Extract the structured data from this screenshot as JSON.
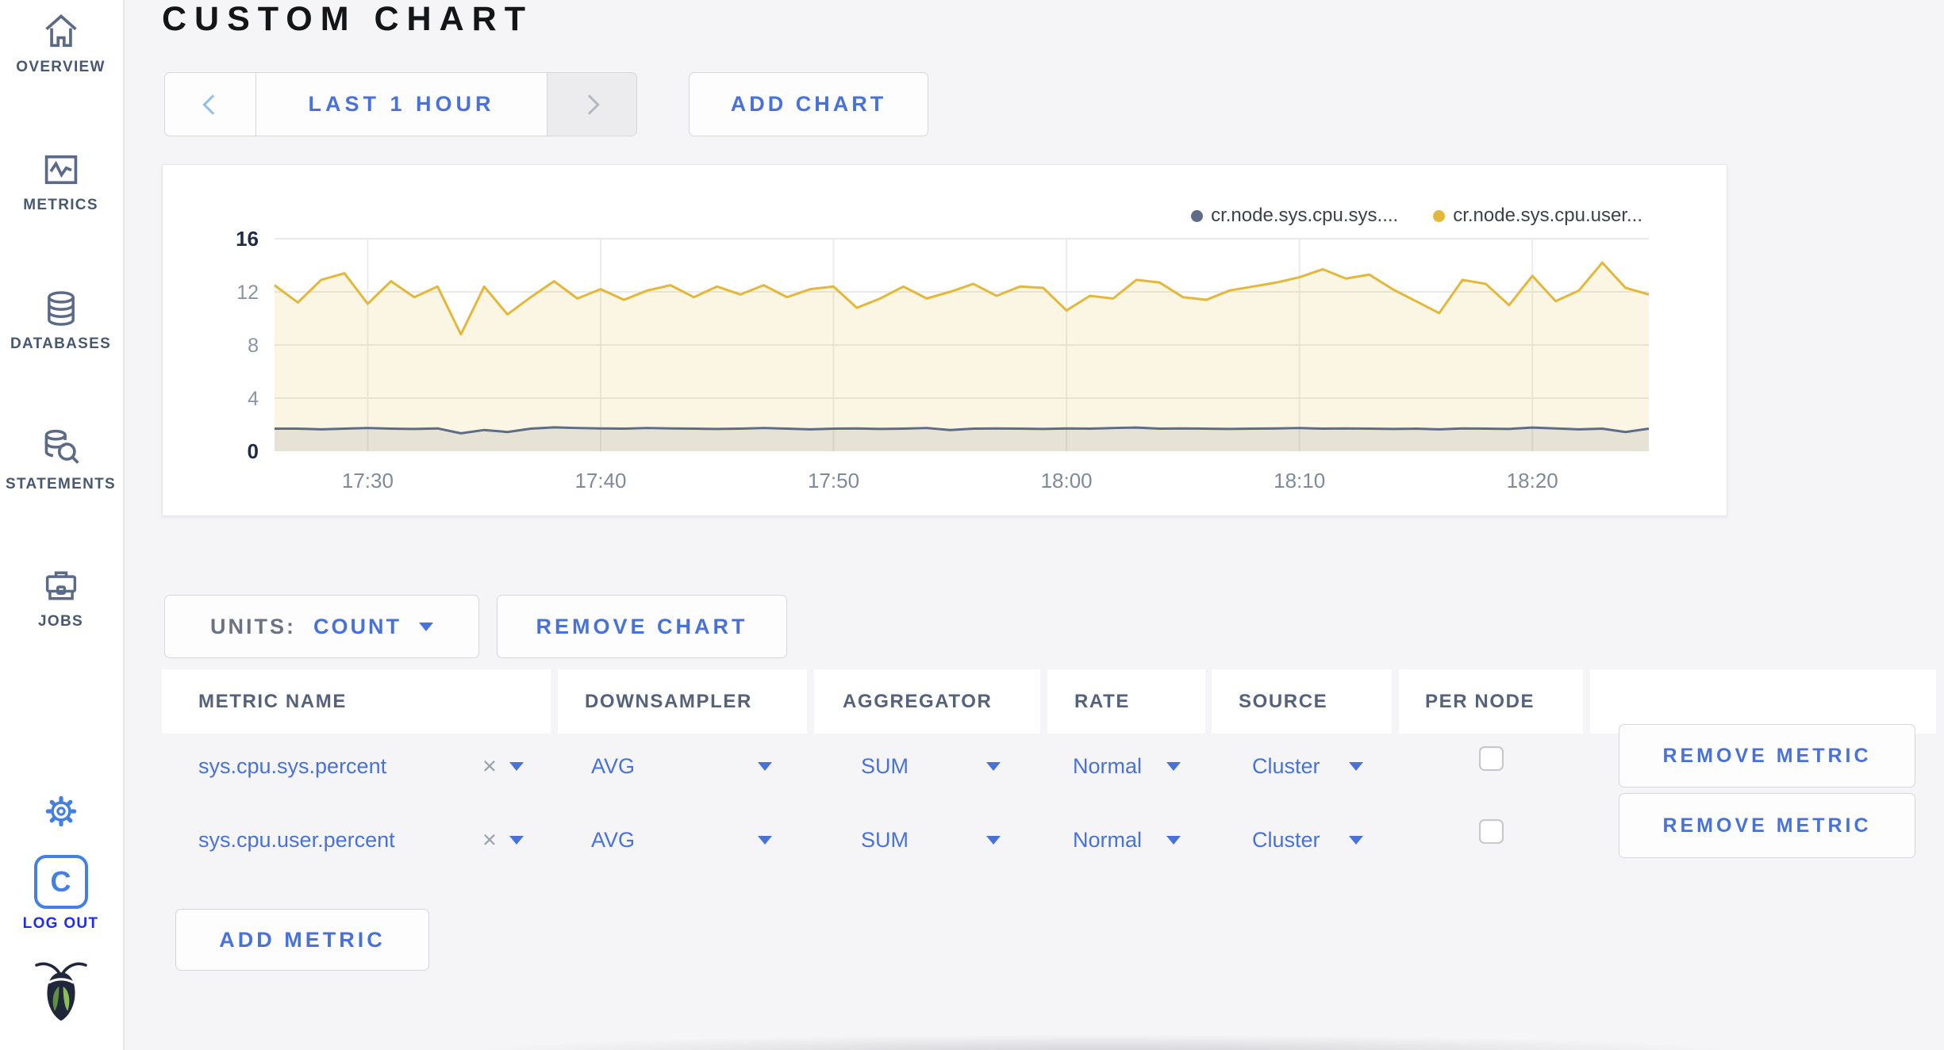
{
  "sidebar": {
    "items": [
      {
        "label": "OVERVIEW",
        "icon": "home-icon"
      },
      {
        "label": "METRICS",
        "icon": "metrics-icon"
      },
      {
        "label": "DATABASES",
        "icon": "database-icon"
      },
      {
        "label": "STATEMENTS",
        "icon": "statements-icon"
      },
      {
        "label": "JOBS",
        "icon": "jobs-icon"
      }
    ],
    "logout_label": "LOG OUT",
    "logo_letter": "C"
  },
  "header": {
    "title": "CUSTOM CHART",
    "time_range": "LAST 1 HOUR",
    "add_chart_label": "ADD CHART"
  },
  "chart_controls": {
    "units_label": "UNITS:",
    "units_value": "COUNT",
    "remove_chart_label": "REMOVE CHART",
    "add_metric_label": "ADD METRIC"
  },
  "icons": {
    "close_x": "×"
  },
  "table": {
    "headers": [
      "METRIC NAME",
      "DOWNSAMPLER",
      "AGGREGATOR",
      "RATE",
      "SOURCE",
      "PER NODE"
    ],
    "rows": [
      {
        "name": "sys.cpu.sys.percent",
        "downsampler": "AVG",
        "aggregator": "SUM",
        "rate": "Normal",
        "source": "Cluster",
        "per_node_checked": false,
        "remove_label": "REMOVE METRIC"
      },
      {
        "name": "sys.cpu.user.percent",
        "downsampler": "AVG",
        "aggregator": "SUM",
        "rate": "Normal",
        "source": "Cluster",
        "per_node_checked": false,
        "remove_label": "REMOVE METRIC"
      }
    ]
  },
  "colors": {
    "link_blue": "#4872d9",
    "icon_blue": "#4480e2",
    "logout_blue": "#1d2cf0",
    "sidebar_text": "#475872",
    "series_sys": "#5f6c87",
    "series_user": "#e3b83a"
  },
  "chart_data": {
    "type": "line",
    "title": "",
    "xlabel": "",
    "ylabel": "",
    "ylim": [
      0,
      16
    ],
    "y_ticks": [
      0,
      4,
      8,
      12,
      16
    ],
    "x_start": "17:26",
    "x_interval_minutes": 1,
    "x_ticks": [
      "17:30",
      "17:40",
      "17:50",
      "18:00",
      "18:10",
      "18:20"
    ],
    "grid": true,
    "legend_position": "top-right",
    "series": [
      {
        "name": "cr.node.sys.cpu.sys....",
        "color": "#5f6c87",
        "fill": "rgba(95,108,135,0.13)",
        "values": [
          1.7,
          1.7,
          1.65,
          1.7,
          1.75,
          1.7,
          1.68,
          1.72,
          1.35,
          1.6,
          1.45,
          1.7,
          1.8,
          1.75,
          1.72,
          1.7,
          1.75,
          1.72,
          1.7,
          1.68,
          1.7,
          1.75,
          1.7,
          1.65,
          1.7,
          1.72,
          1.68,
          1.7,
          1.75,
          1.6,
          1.7,
          1.72,
          1.7,
          1.68,
          1.72,
          1.7,
          1.75,
          1.78,
          1.7,
          1.72,
          1.7,
          1.68,
          1.7,
          1.72,
          1.75,
          1.7,
          1.72,
          1.7,
          1.68,
          1.7,
          1.65,
          1.72,
          1.7,
          1.68,
          1.78,
          1.72,
          1.65,
          1.7,
          1.45,
          1.7
        ]
      },
      {
        "name": "cr.node.sys.cpu.user...",
        "color": "#e3b83a",
        "fill": "rgba(226,185,59,0.14)",
        "values": [
          12.5,
          11.2,
          12.9,
          13.4,
          11.1,
          12.8,
          11.6,
          12.4,
          8.8,
          12.4,
          10.3,
          11.6,
          12.8,
          11.5,
          12.2,
          11.4,
          12.1,
          12.5,
          11.6,
          12.4,
          11.8,
          12.5,
          11.6,
          12.2,
          12.4,
          10.8,
          11.5,
          12.4,
          11.5,
          12.0,
          12.6,
          11.7,
          12.4,
          12.3,
          10.6,
          11.7,
          11.5,
          12.9,
          12.7,
          11.6,
          11.4,
          12.1,
          12.4,
          12.7,
          13.1,
          13.7,
          13.0,
          13.3,
          12.2,
          11.3,
          10.4,
          12.9,
          12.6,
          11.0,
          13.2,
          11.3,
          12.1,
          14.2,
          12.3,
          11.8
        ]
      }
    ]
  }
}
